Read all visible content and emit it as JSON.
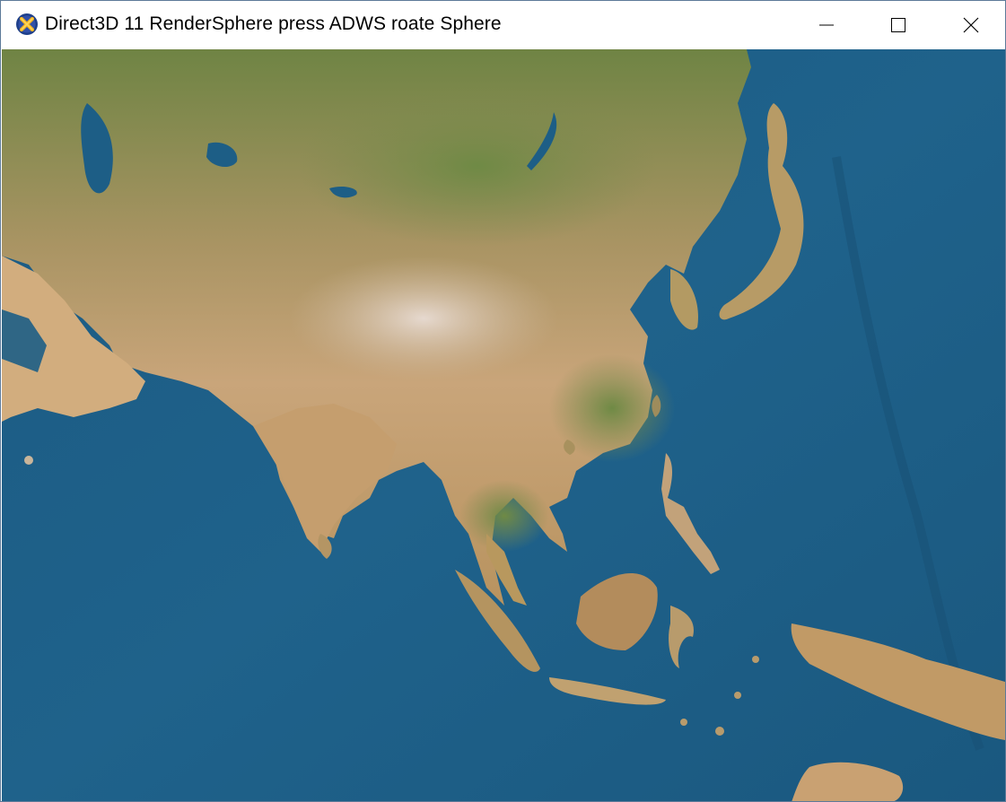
{
  "window": {
    "title": "Direct3D 11 RenderSphere press ADWS roate Sphere",
    "app_icon": "directx-x-icon",
    "controls": {
      "minimize_icon": "minimize-icon",
      "maximize_icon": "maximize-icon",
      "close_icon": "close-icon"
    }
  },
  "colors": {
    "ocean": "#1d5e86",
    "ocean_deep": "#174f74",
    "land_desert": "#c9a57a",
    "land_green": "#7c8a4e",
    "land_highland": "#d8c8b4",
    "icon_ring": "#1e3f8a",
    "icon_x": "#f2b01e"
  }
}
